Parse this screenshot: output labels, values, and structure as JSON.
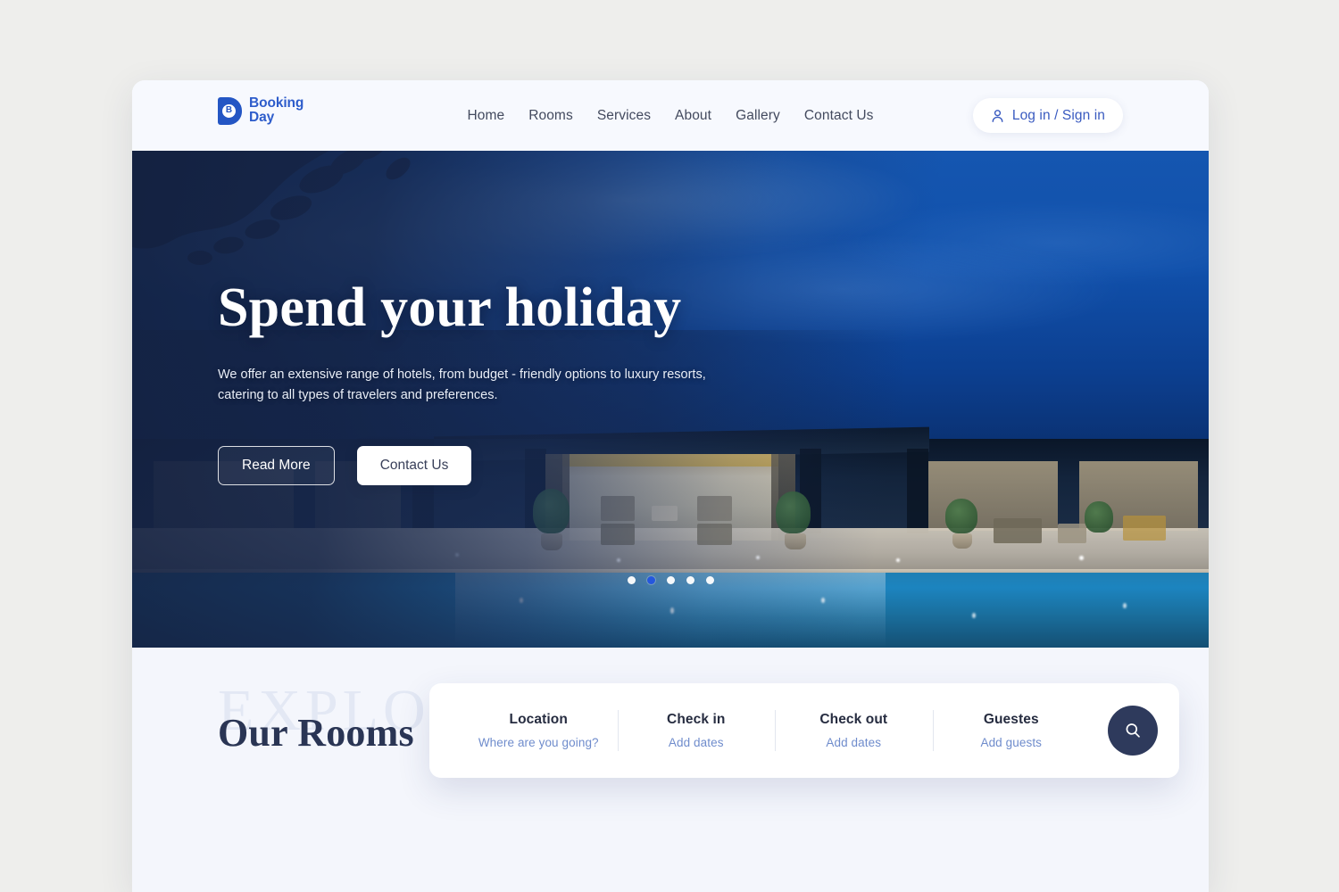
{
  "brand": {
    "badge_letter": "B",
    "line1": "Booking",
    "line2": "Day",
    "color": "#2456c4"
  },
  "nav": {
    "items": [
      {
        "label": "Home"
      },
      {
        "label": "Rooms"
      },
      {
        "label": "Services"
      },
      {
        "label": "About"
      },
      {
        "label": "Gallery"
      },
      {
        "label": "Contact Us"
      }
    ]
  },
  "auth": {
    "label": "Log in / Sign in",
    "icon": "person-icon",
    "text_color": "#3a5bc0"
  },
  "hero": {
    "title": "Spend your holiday",
    "subtitle": "We offer an extensive range of hotels, from budget - friendly options to luxury resorts, catering to all types of travelers and preferences.",
    "primary_button": "Read More",
    "secondary_button": "Contact Us",
    "carousel": {
      "total": 5,
      "active_index": 1,
      "active_color": "#2456e0",
      "inactive_color": "#ffffff"
    }
  },
  "search": {
    "fields": [
      {
        "label": "Location",
        "value": "Where are you going?"
      },
      {
        "label": "Check in",
        "value": "Add dates"
      },
      {
        "label": "Check out",
        "value": "Add dates"
      },
      {
        "label": "Guestes",
        "value": "Add guests"
      }
    ],
    "button_icon": "search-icon",
    "button_color": "#2e3a5c"
  },
  "rooms": {
    "watermark": "EXPLORE",
    "title": "Our Rooms",
    "prev_icon": "arrow-left-icon",
    "next_icon": "arrow-right-icon",
    "next_color": "#2d56cf"
  }
}
